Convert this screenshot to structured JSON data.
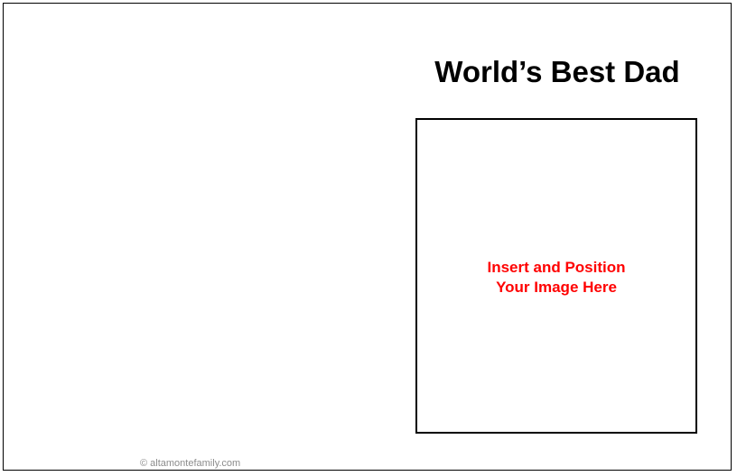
{
  "card": {
    "title": "World’s Best Dad",
    "photo_placeholder": {
      "line1": "Insert and Position",
      "line2": "Your Image Here"
    },
    "copyright": "© altamontefamily.com"
  },
  "colors": {
    "border": "#000000",
    "title": "#000000",
    "placeholder_text": "#ff0000",
    "copyright_text": "#8c8c8c",
    "background": "#ffffff"
  }
}
